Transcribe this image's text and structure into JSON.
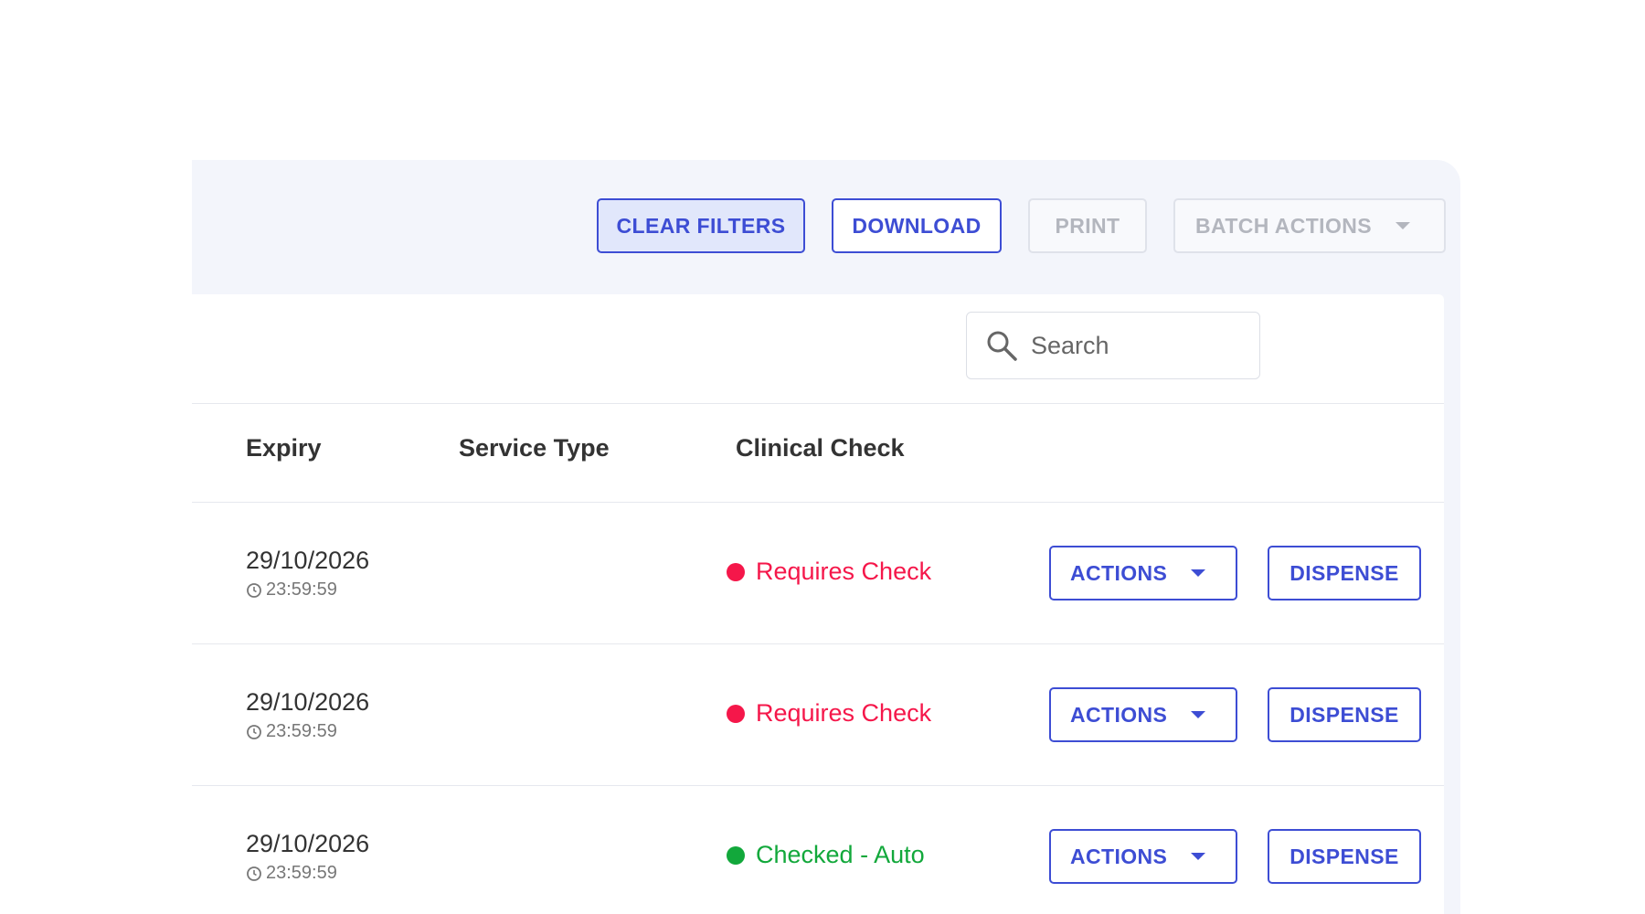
{
  "toolbar": {
    "clear_filters": "CLEAR FILTERS",
    "download": "DOWNLOAD",
    "print": "PRINT",
    "batch_actions": "BATCH ACTIONS"
  },
  "search": {
    "placeholder": "Search"
  },
  "table": {
    "headers": {
      "expiry": "Expiry",
      "service_type": "Service Type",
      "clinical_check": "Clinical Check"
    },
    "rows": [
      {
        "expiry_date": "29/10/2026",
        "expiry_time": "23:59:59",
        "service_type": "",
        "clinical_check": "Requires Check",
        "actions": "ACTIONS",
        "dispense": "DISPENSE"
      },
      {
        "expiry_date": "29/10/2026",
        "expiry_time": "23:59:59",
        "service_type": "",
        "clinical_check": "Requires Check",
        "actions": "ACTIONS",
        "dispense": "DISPENSE"
      },
      {
        "expiry_date": "29/10/2026",
        "expiry_time": "23:59:59",
        "service_type": "",
        "clinical_check": "Checked - Auto",
        "actions": "ACTIONS",
        "dispense": "DISPENSE"
      }
    ]
  },
  "colors": {
    "primary": "#3d4dd4",
    "requires_check": "#f5174a",
    "checked_auto": "#12a83b",
    "panel_bg": "#f3f5fb"
  },
  "icons": {
    "search": "search-icon",
    "clock": "clock-icon",
    "caret": "caret-down-icon"
  }
}
